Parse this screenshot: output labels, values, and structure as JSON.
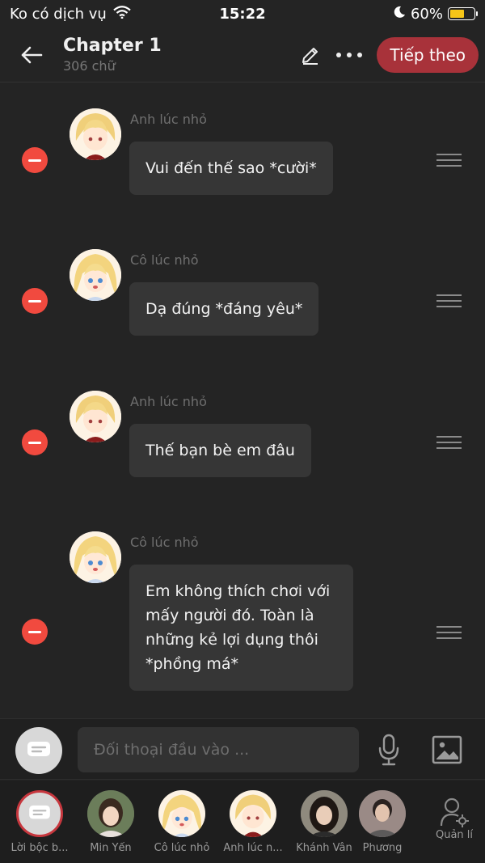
{
  "status_bar": {
    "carrier": "Ko có dịch vụ",
    "time": "15:22",
    "battery": "60%",
    "battery_level": 0.6
  },
  "header": {
    "title": "Chapter 1",
    "word_count": "306 chữ",
    "next_label": "Tiếp theo"
  },
  "messages": [
    {
      "speaker": "Anh lúc nhỏ",
      "text": "Vui đến thế sao *cười*",
      "avatar": "boy-blonde"
    },
    {
      "speaker": "Cô lúc nhỏ",
      "text": "Dạ đúng *đáng yêu*",
      "avatar": "girl-blonde"
    },
    {
      "speaker": "Anh lúc nhỏ",
      "text": "Thế bạn bè em đâu",
      "avatar": "boy-blonde"
    },
    {
      "speaker": "Cô lúc nhỏ",
      "text": "Em không thích chơi với mấy người đó. Toàn là những kẻ lợi dụng thôi *phồng má*",
      "avatar": "girl-blonde"
    }
  ],
  "input": {
    "placeholder": "Đối thoại đầu vào ..."
  },
  "characters": [
    {
      "label": "Lời bộc b...",
      "avatar": "narrator"
    },
    {
      "label": "Min Yến",
      "avatar": "photo-girl"
    },
    {
      "label": "Cô lúc nhỏ",
      "avatar": "girl-blonde"
    },
    {
      "label": "Anh lúc n...",
      "avatar": "boy-blonde"
    },
    {
      "label": "Khánh Vân",
      "avatar": "photo-girl-2"
    },
    {
      "label": "Phương",
      "avatar": "photo-boy"
    }
  ],
  "manage_label": "Quản lí",
  "colors": {
    "accent": "#a8323a",
    "remove": "#f14a3f",
    "background": "#242424",
    "bubble": "#363636"
  }
}
